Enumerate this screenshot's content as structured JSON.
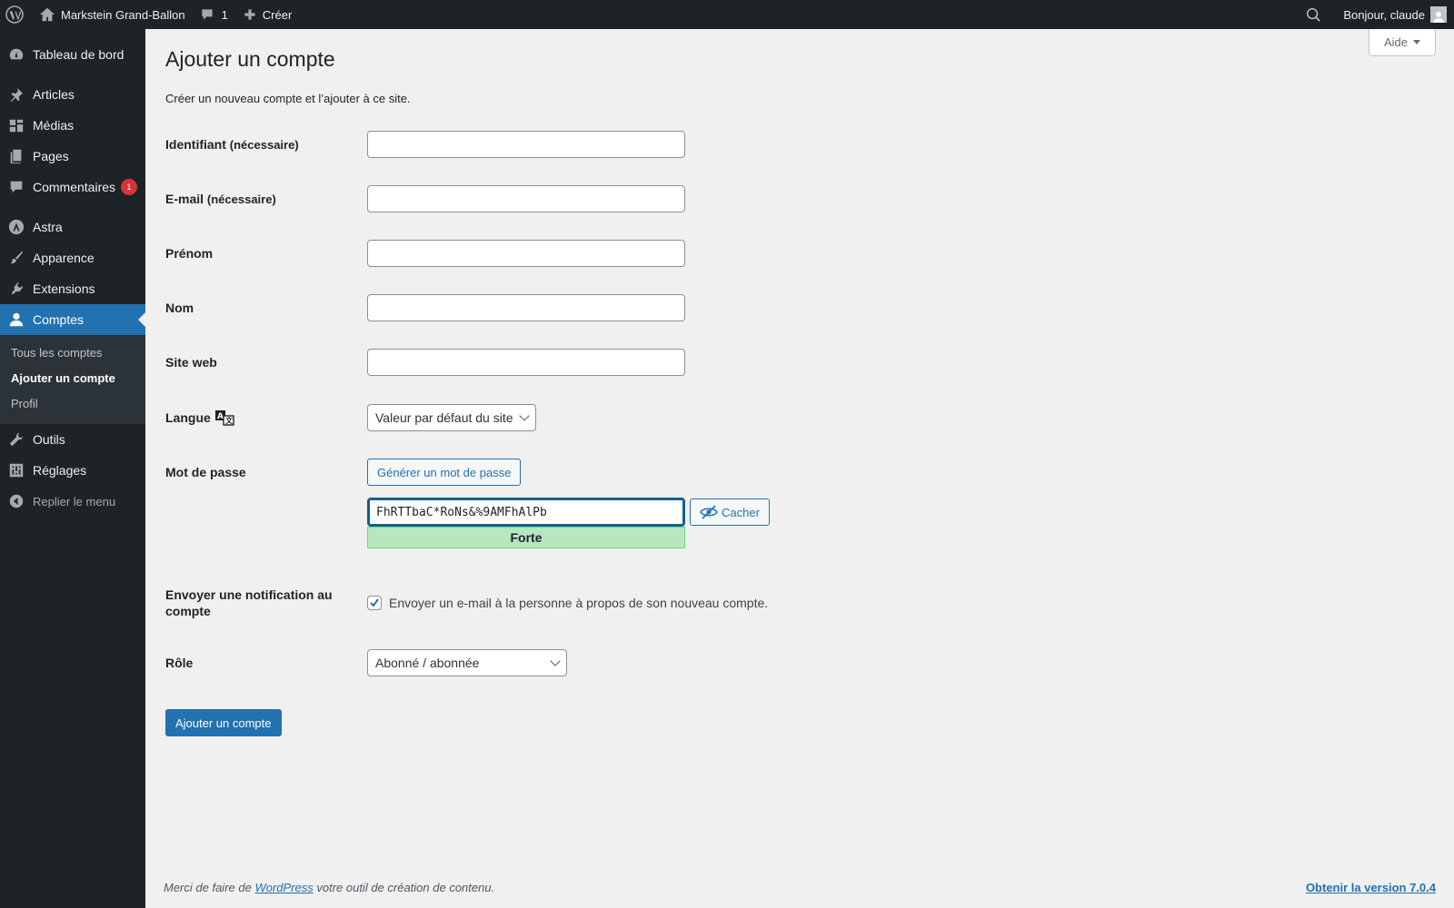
{
  "adminbar": {
    "site_name": "Markstein Grand-Ballon",
    "comments_count": "1",
    "new_label": "Créer",
    "greeting": "Bonjour, claude"
  },
  "sidebar": {
    "items": [
      {
        "label": "Tableau de bord",
        "icon": "dashboard-icon"
      },
      {
        "label": "Articles",
        "icon": "pin-icon"
      },
      {
        "label": "Médias",
        "icon": "media-icon"
      },
      {
        "label": "Pages",
        "icon": "pages-icon"
      },
      {
        "label": "Commentaires",
        "icon": "comment-icon",
        "badge": "1"
      },
      {
        "label": "Astra",
        "icon": "astra-icon"
      },
      {
        "label": "Apparence",
        "icon": "brush-icon"
      },
      {
        "label": "Extensions",
        "icon": "plugin-icon"
      },
      {
        "label": "Comptes",
        "icon": "user-icon",
        "current": true
      },
      {
        "label": "Outils",
        "icon": "wrench-icon"
      },
      {
        "label": "Réglages",
        "icon": "settings-icon"
      },
      {
        "label": "Replier le menu",
        "icon": "collapse-icon"
      }
    ],
    "submenu": [
      "Tous les comptes",
      "Ajouter un compte",
      "Profil"
    ]
  },
  "help_label": "Aide",
  "page": {
    "title": "Ajouter un compte",
    "description": "Créer un nouveau compte et l’ajouter à ce site."
  },
  "form": {
    "username_label": "Identifiant",
    "required": "(nécessaire)",
    "email_label": "E-mail",
    "firstname_label": "Prénom",
    "lastname_label": "Nom",
    "website_label": "Site web",
    "language_label": "Langue",
    "language_value": "Valeur par défaut du site",
    "password_label": "Mot de passe",
    "generate_label": "Générer un mot de passe",
    "password_value": "FhRTTbaC*RoNs&%9AMFhAlPb",
    "hide_label": "Cacher",
    "strength": "Forte",
    "notify_label": "Envoyer une notification au compte",
    "notify_text": "Envoyer un e-mail à la personne à propos de son nouveau compte.",
    "notify_checked": true,
    "role_label": "Rôle",
    "role_value": "Abonné / abonnée",
    "submit_label": "Ajouter un compte"
  },
  "footer": {
    "thanks_prefix": "Merci de faire de ",
    "thanks_link": "WordPress",
    "thanks_suffix": " votre outil de création de contenu.",
    "upgrade": "Obtenir la version 7.0.4"
  },
  "colors": {
    "admin_dark": "#1d2327",
    "accent": "#2271b1",
    "badge": "#d63638",
    "strength_bg": "#b8e6bf"
  }
}
